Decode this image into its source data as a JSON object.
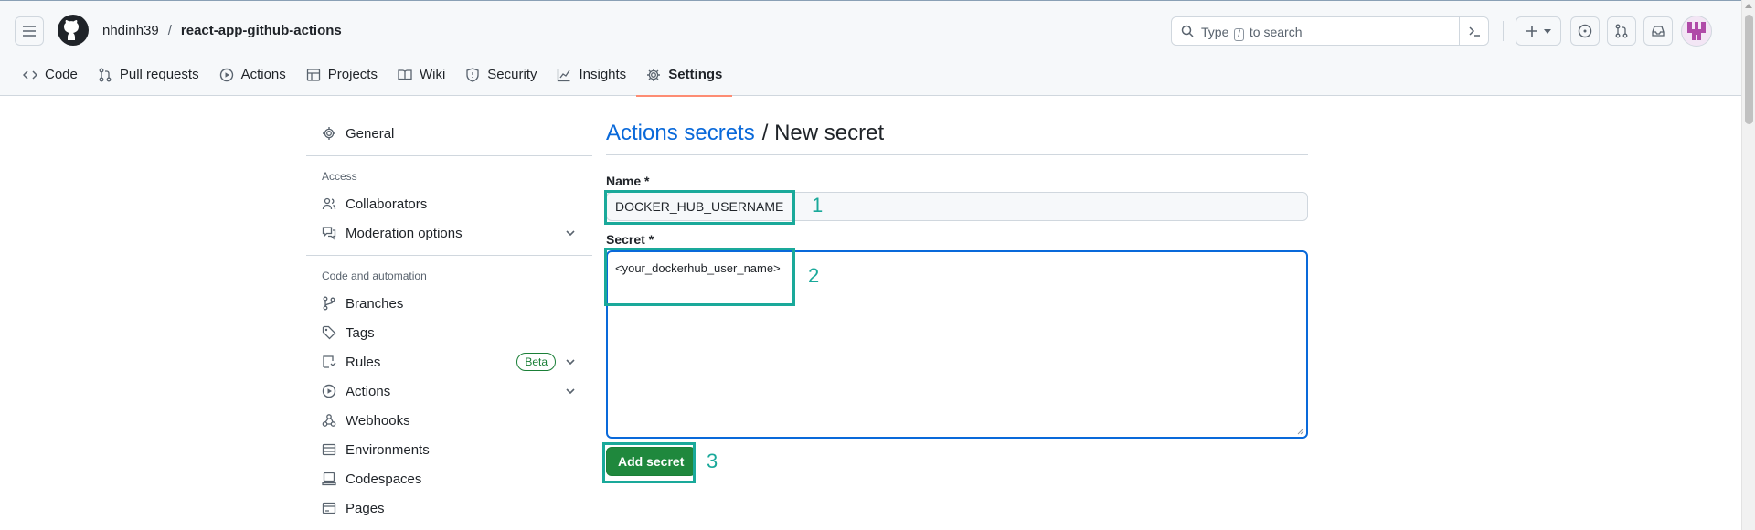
{
  "repo": {
    "owner": "nhdinh39",
    "separator": "/",
    "name": "react-app-github-actions"
  },
  "search": {
    "prefix": "Type",
    "key": "/",
    "suffix": "to search"
  },
  "tabs": [
    {
      "label": "Code",
      "icon": "code-icon"
    },
    {
      "label": "Pull requests",
      "icon": "pull-request-icon"
    },
    {
      "label": "Actions",
      "icon": "play-icon"
    },
    {
      "label": "Projects",
      "icon": "table-icon"
    },
    {
      "label": "Wiki",
      "icon": "book-icon"
    },
    {
      "label": "Security",
      "icon": "shield-icon"
    },
    {
      "label": "Insights",
      "icon": "graph-icon"
    },
    {
      "label": "Settings",
      "icon": "gear-icon",
      "active": true
    }
  ],
  "sidebar": {
    "general": "General",
    "access_heading": "Access",
    "collaborators": "Collaborators",
    "moderation": "Moderation options",
    "code_heading": "Code and automation",
    "branches": "Branches",
    "tags": "Tags",
    "rules": "Rules",
    "rules_badge": "Beta",
    "actions": "Actions",
    "webhooks": "Webhooks",
    "environments": "Environments",
    "codespaces": "Codespaces",
    "pages": "Pages"
  },
  "main": {
    "title_link": "Actions secrets",
    "title_rest": "/ New secret",
    "name_label": "Name *",
    "name_value": "DOCKER_HUB_USERNAME",
    "secret_label": "Secret *",
    "secret_value": "<your_dockerhub_user_name>",
    "submit_label": "Add secret"
  },
  "annotations": [
    "1",
    "2",
    "3"
  ],
  "colors": {
    "accent": "#0969da",
    "primary_button": "#1f883d",
    "annotation": "#1aa99a",
    "active_tab_underline": "#fd8c73"
  }
}
